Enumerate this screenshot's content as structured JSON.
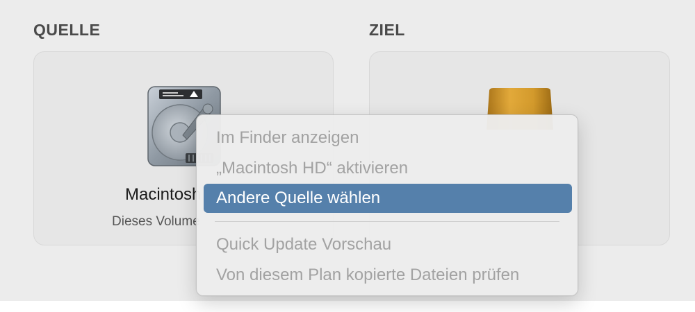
{
  "source": {
    "heading": "QUELLE",
    "volume_name": "Macintosh HD",
    "volume_subtitle": "Dieses Volume"
  },
  "destination": {
    "heading": "ZIEL"
  },
  "context_menu": {
    "items": [
      {
        "label": "Im Finder anzeigen",
        "enabled": false
      },
      {
        "label": "„Macintosh HD“ aktivieren",
        "enabled": false
      },
      {
        "label": "Andere Quelle wählen",
        "enabled": true,
        "highlighted": true
      },
      {
        "label": "Quick Update Vorschau",
        "enabled": false
      },
      {
        "label": "Von diesem Plan kopierte Dateien prüfen",
        "enabled": false
      }
    ]
  },
  "colors": {
    "highlight": "#5580ab",
    "disabled_text": "#a2a2a2",
    "drive_gold": "#d39a2c"
  },
  "icons": {
    "source_drive": "internal-hard-drive-icon",
    "destination_drive": "external-drive-icon"
  }
}
